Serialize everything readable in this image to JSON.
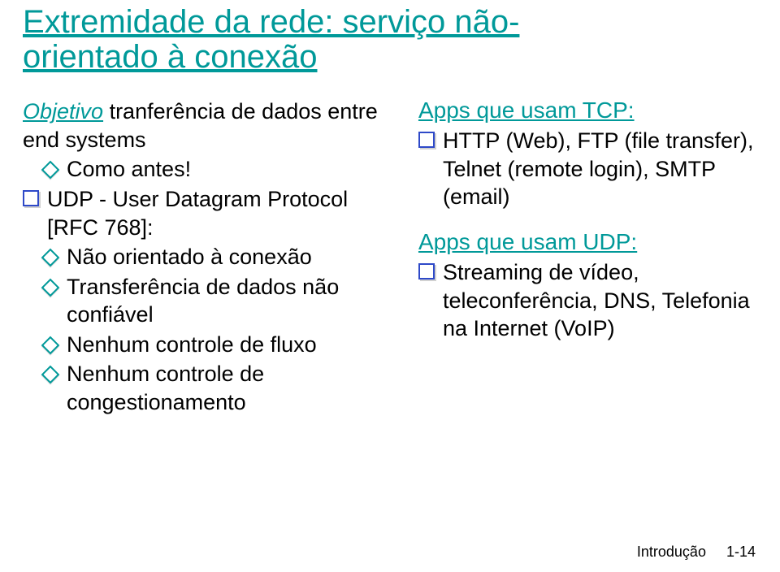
{
  "title_line1": "Extremidade da rede: serviço não-",
  "title_line2": "orientado à conexão",
  "left": {
    "objective_label": "Objetivo",
    "objective_rest": " tranferência de dados entre end systems",
    "como_antes": "Como antes!",
    "udp": "UDP - User Datagram Protocol [RFC 768]:",
    "b1": "Não orientado à conexão",
    "b2": "Transferência de dados não confiável",
    "b3": "Nenhum controle de fluxo",
    "b4": "Nenhum controle de congestionamento"
  },
  "right": {
    "tcp_head": "Apps que usam TCP:",
    "tcp_item": "HTTP (Web), FTP (file transfer), Telnet (remote login), SMTP (email)",
    "udp_head": "Apps que usam UDP:",
    "udp_item": "Streaming de vídeo, teleconferência, DNS, Telefonia na Internet (VoIP)"
  },
  "footer_label": "Introdução",
  "footer_page": "1-14"
}
